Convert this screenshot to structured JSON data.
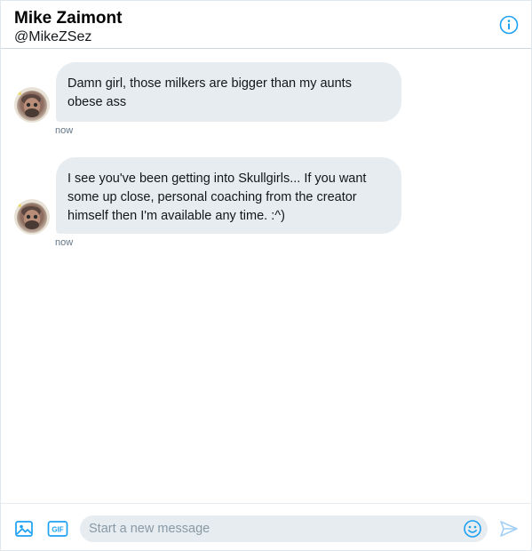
{
  "header": {
    "display_name": "Mike Zaimont",
    "handle": "@MikeZSez",
    "info_icon": "info-circle-icon"
  },
  "messages": [
    {
      "text": "Damn girl, those milkers are bigger than my aunts obese ass",
      "time": "now"
    },
    {
      "text": "I see you've been getting into Skullgirls... If you want some up close, personal coaching from the creator himself then I'm available any time. :^)",
      "time": "now"
    }
  ],
  "composer": {
    "placeholder": "Start a new message",
    "value": "",
    "media_icon": "image-icon",
    "gif_icon": "gif-icon",
    "gif_label": "GIF",
    "emoji_icon": "smiley-icon",
    "send_icon": "send-icon"
  },
  "colors": {
    "accent": "#1da1f2",
    "bubble": "#e6ecf0",
    "timestamp": "#657786",
    "placeholder": "#8899a6"
  }
}
